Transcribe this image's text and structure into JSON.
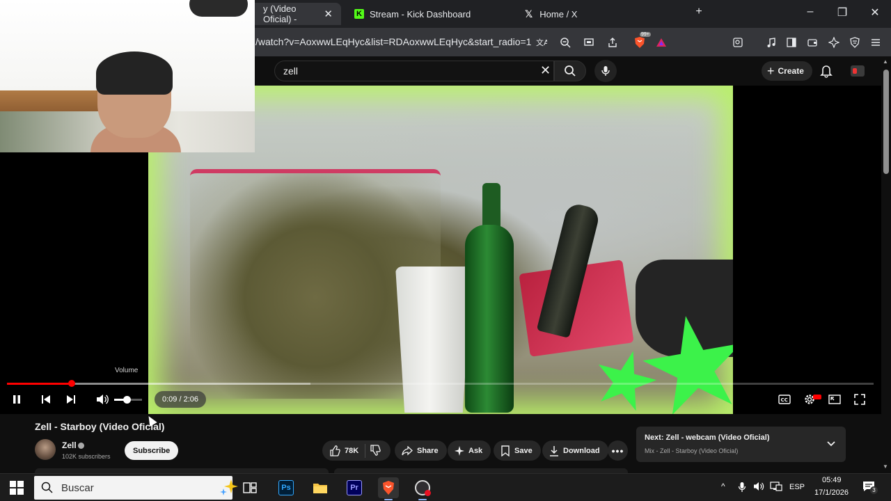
{
  "browser": {
    "tabs": [
      {
        "label": "y (Video Oficial) -",
        "active": true
      },
      {
        "label": "Stream - Kick Dashboard",
        "active": false
      },
      {
        "label": "Home / X",
        "active": false
      }
    ],
    "url": "/watch?v=AoxwwLEqHyc&list=RDAoxwwLEqHyc&start_radio=1",
    "shield_badge": "99+"
  },
  "youtube": {
    "search_value": "zell",
    "create_label": "Create"
  },
  "player": {
    "volume_tooltip": "Volume",
    "time": "0:09 / 2:06",
    "progress_fraction": 0.075,
    "buffer_fraction": 0.35,
    "volume_fraction": 0.45
  },
  "video": {
    "title": "Zell - Starboy (Video Oficial)",
    "channel": "Zell",
    "subscribers": "102K subscribers",
    "subscribe_label": "Subscribe",
    "likes": "78K",
    "share_label": "Share",
    "ask_label": "Ask",
    "save_label": "Save",
    "download_label": "Download"
  },
  "next_card": {
    "label": "Next: Zell - webcam (Video Oficial)",
    "sub": "Mix - Zell - Starboy (Video Oficial)"
  },
  "taskbar": {
    "search_placeholder": "Buscar",
    "language": "ESP",
    "time": "05:49",
    "date": "17/1/2026",
    "notification_count": "3"
  },
  "colors": {
    "accent_red": "#ff0000",
    "tab_bg": "#202124",
    "page_bg": "#0f0f0f"
  }
}
